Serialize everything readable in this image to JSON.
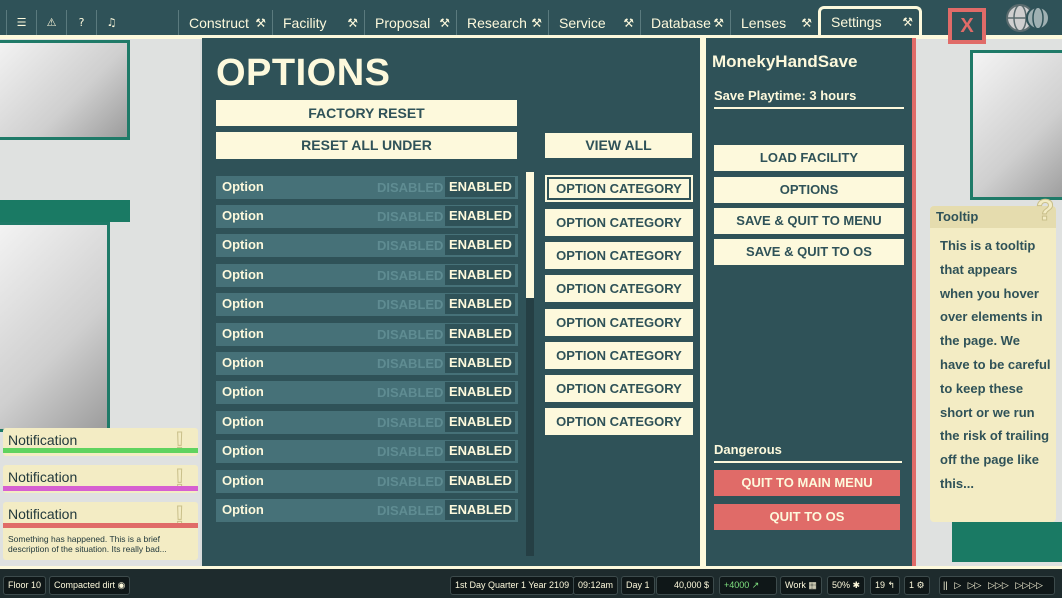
{
  "topbar": {
    "quick_icons": [
      "list-icon",
      "warning-icon",
      "help-icon",
      "bell-icon"
    ],
    "tabs": [
      {
        "label": "Construct",
        "icon": "hammer-icon"
      },
      {
        "label": "Facility",
        "icon": "hammer-icon"
      },
      {
        "label": "Proposal",
        "icon": "hammer-icon"
      },
      {
        "label": "Research",
        "icon": "hammer-icon"
      },
      {
        "label": "Service",
        "icon": "hammer-icon"
      },
      {
        "label": "Database",
        "icon": "hammer-icon"
      },
      {
        "label": "Lenses",
        "icon": "hammer-icon"
      },
      {
        "label": "Settings",
        "icon": "hammer-icon",
        "active": true
      }
    ],
    "close_label": "X"
  },
  "options": {
    "title": "OPTIONS",
    "factory_reset": "FACTORY RESET",
    "reset_all_under": "RESET ALL UNDER",
    "view_all": "VIEW ALL",
    "rows": [
      {
        "label": "Option",
        "disabled": "DISABLED",
        "enabled": "ENABLED"
      },
      {
        "label": "Option",
        "disabled": "DISABLED",
        "enabled": "ENABLED"
      },
      {
        "label": "Option",
        "disabled": "DISABLED",
        "enabled": "ENABLED"
      },
      {
        "label": "Option",
        "disabled": "DISABLED",
        "enabled": "ENABLED"
      },
      {
        "label": "Option",
        "disabled": "DISABLED",
        "enabled": "ENABLED"
      },
      {
        "label": "Option",
        "disabled": "DISABLED",
        "enabled": "ENABLED"
      },
      {
        "label": "Option",
        "disabled": "DISABLED",
        "enabled": "ENABLED"
      },
      {
        "label": "Option",
        "disabled": "DISABLED",
        "enabled": "ENABLED"
      },
      {
        "label": "Option",
        "disabled": "DISABLED",
        "enabled": "ENABLED"
      },
      {
        "label": "Option",
        "disabled": "DISABLED",
        "enabled": "ENABLED"
      },
      {
        "label": "Option",
        "disabled": "DISABLED",
        "enabled": "ENABLED"
      },
      {
        "label": "Option",
        "disabled": "DISABLED",
        "enabled": "ENABLED"
      }
    ],
    "categories": [
      "OPTION CATEGORY",
      "OPTION CATEGORY",
      "OPTION CATEGORY",
      "OPTION CATEGORY",
      "OPTION CATEGORY",
      "OPTION CATEGORY",
      "OPTION CATEGORY",
      "OPTION CATEGORY"
    ]
  },
  "save": {
    "name": "MonekyHandSave",
    "playtime": "Save Playtime: 3 hours",
    "buttons": [
      "LOAD FACILITY",
      "OPTIONS",
      "SAVE & QUIT TO MENU",
      "SAVE & QUIT TO OS"
    ],
    "dangerous_label": "Dangerous",
    "danger_buttons": [
      "QUIT TO MAIN MENU",
      "QUIT TO OS"
    ]
  },
  "tooltip": {
    "title": "Tooltip",
    "icon": "question-icon",
    "body": "This is a tooltip that appears when you hover over elements in the page. We have to be careful to keep these short or we run the risk of trailing off the page like this..."
  },
  "notifications": [
    {
      "title": "Notification",
      "color": "#5fd35f"
    },
    {
      "title": "Notification",
      "color": "#d65fd1"
    },
    {
      "title": "Notification",
      "color": "#e06b68",
      "description": "Something has happened.  This is a brief description of the situation. Its really bad..."
    }
  ],
  "statusbar": {
    "floor": "Floor 10",
    "terrain": "Compacted dirt",
    "date": "1st Day Quarter 1 Year 2109",
    "time": "09:12am",
    "day": "Day 1",
    "money": "40,000",
    "money_symbol": "$",
    "income": "+4000",
    "work": "Work",
    "percent": "50%",
    "count_a": "19",
    "count_b": "1",
    "speed_controls": [
      "||",
      "▷",
      "▷▷",
      "▷▷▷",
      "▷▷▷▷"
    ]
  },
  "colors": {
    "panel": "#2f5258",
    "cream": "#fdf9dc",
    "danger": "#e06b68"
  }
}
